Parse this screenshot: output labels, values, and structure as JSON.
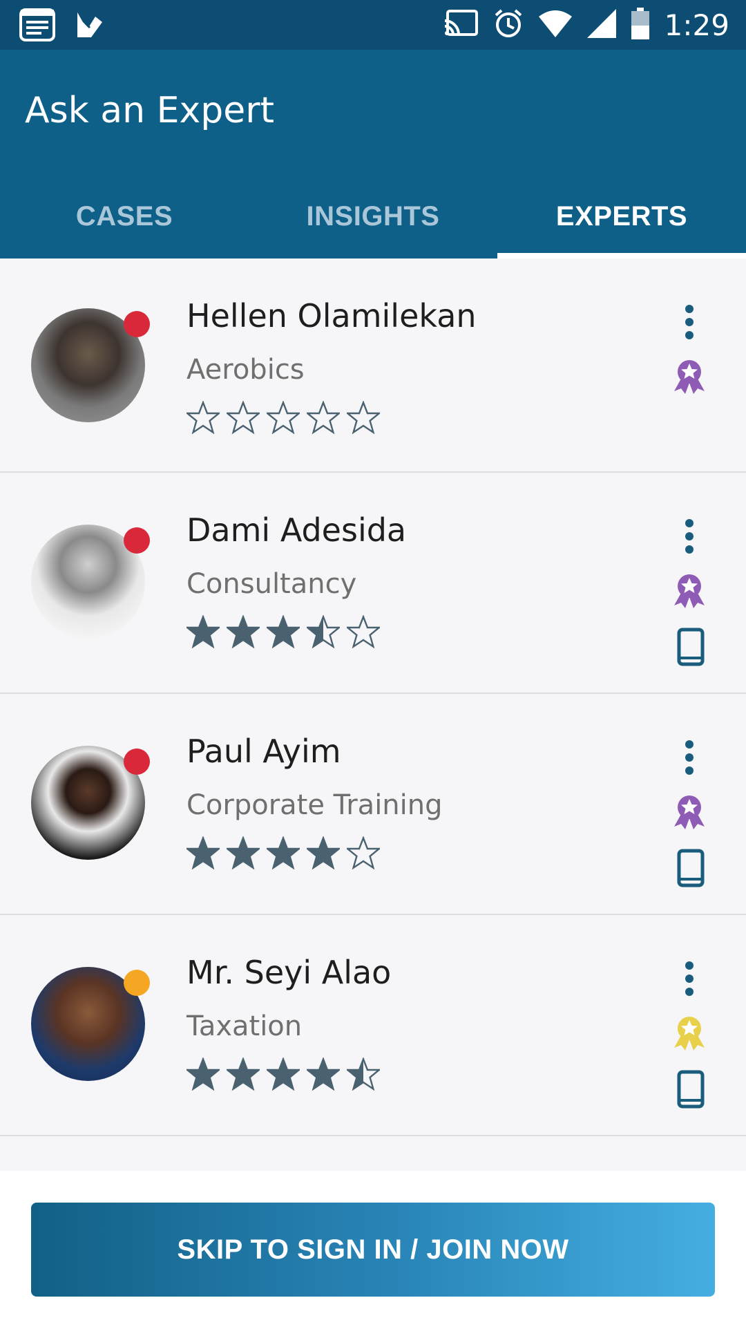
{
  "status_bar": {
    "time": "1:29",
    "icons": [
      "notes-icon",
      "check-icon",
      "cast-icon",
      "alarm-icon",
      "wifi-icon",
      "signal-icon",
      "battery-icon"
    ]
  },
  "app": {
    "title": "Ask an Expert"
  },
  "tabs": [
    {
      "label": "CASES",
      "active": false
    },
    {
      "label": "INSIGHTS",
      "active": false
    },
    {
      "label": "EXPERTS",
      "active": true
    }
  ],
  "experts": [
    {
      "name": "Hellen Olamilekan",
      "category": "Aerobics",
      "rating": 0,
      "status_color": "#d9283a",
      "badge_color": "#8e5bb5",
      "has_phone": false
    },
    {
      "name": "Dami Adesida",
      "category": "Consultancy",
      "rating": 3.5,
      "status_color": "#d9283a",
      "badge_color": "#8e5bb5",
      "has_phone": true
    },
    {
      "name": "Paul Ayim",
      "category": "Corporate Training",
      "rating": 4,
      "status_color": "#d9283a",
      "badge_color": "#8e5bb5",
      "has_phone": true
    },
    {
      "name": "Mr. Seyi Alao",
      "category": "Taxation",
      "rating": 4.5,
      "status_color": "#f5a623",
      "badge_color": "#e8d04a",
      "has_phone": true
    }
  ],
  "footer": {
    "cta_label": "SKIP TO SIGN IN / JOIN NOW"
  },
  "colors": {
    "status_bar": "#0d4d73",
    "app_bar": "#0f6089",
    "star": "#4a6270",
    "icon_blue": "#1a5c7e"
  }
}
